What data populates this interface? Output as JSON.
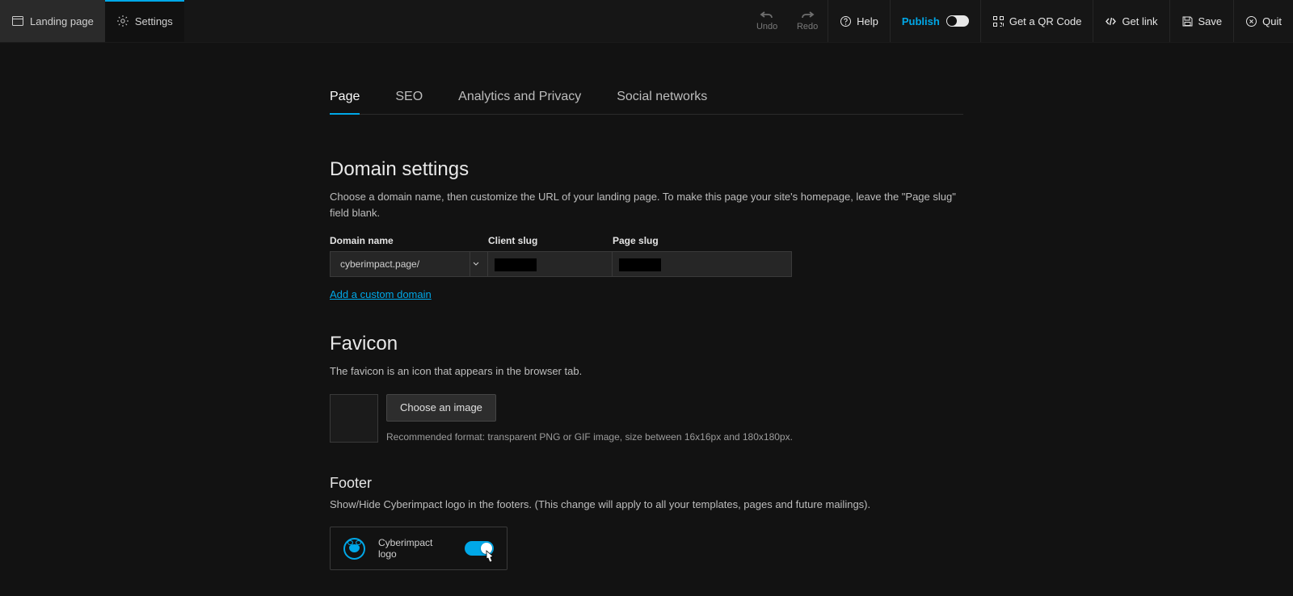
{
  "topbar": {
    "tabs": [
      {
        "label": "Landing page"
      },
      {
        "label": "Settings"
      }
    ],
    "undo": "Undo",
    "redo": "Redo",
    "help": "Help",
    "publish": "Publish",
    "publish_on": false,
    "qr": "Get a QR Code",
    "get_link": "Get link",
    "save": "Save",
    "quit": "Quit"
  },
  "subtabs": {
    "page": "Page",
    "seo": "SEO",
    "analytics": "Analytics and Privacy",
    "social": "Social networks"
  },
  "domain": {
    "title": "Domain settings",
    "desc": "Choose a domain name, then customize the URL of your landing page. To make this page your site's homepage, leave the \"Page slug\" field blank.",
    "name_label": "Domain name",
    "client_label": "Client slug",
    "page_label": "Page slug",
    "domain_value": "cyberimpact.page/",
    "add_custom": "Add a custom domain"
  },
  "favicon": {
    "title": "Favicon",
    "desc": "The favicon is an icon that appears in the browser tab.",
    "choose": "Choose an image",
    "hint": "Recommended format: transparent PNG or GIF image, size between 16x16px and 180x180px."
  },
  "footer": {
    "title": "Footer",
    "desc": "Show/Hide Cyberimpact logo in the footers. (This change will apply to all your templates, pages and future mailings).",
    "logo_label": "Cyberimpact logo",
    "logo_on": true
  }
}
